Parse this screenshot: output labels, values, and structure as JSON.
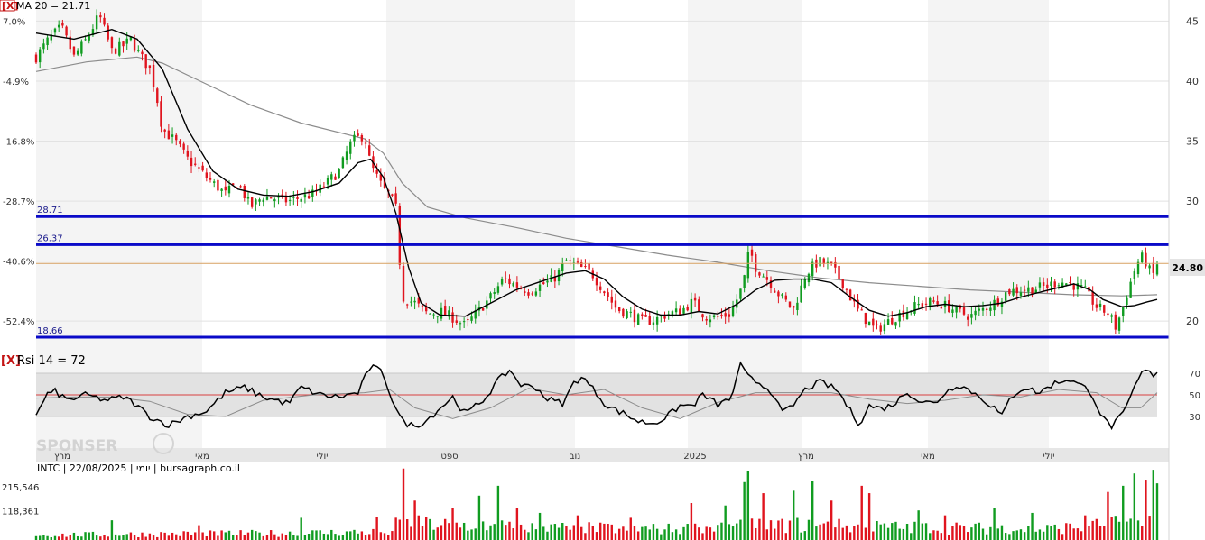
{
  "header": {
    "ma_label": "MA 20 = 21.71",
    "close_marker": "[X]"
  },
  "rsi": {
    "label": "Rsi 14 = 72",
    "close_marker": "[X]",
    "levels": [
      70,
      50,
      30
    ]
  },
  "ticker_line": "INTC | 22/08/2025 | יומי | bursagraph.co.il",
  "watermark": "SPONSER",
  "last_price_label": "24.80",
  "colors": {
    "up": "#109c20",
    "down": "#e0141e",
    "ma_fast": "#000000",
    "ma_slow": "#8c8c8c",
    "level_lines": "#0a0ac8",
    "last_price_line": "#d7a060",
    "rsi_band": "#e2e2e2",
    "rsi_mid": "#d84040"
  },
  "chart_data": [
    {
      "type": "candlestick",
      "name": "price",
      "right_axis_ticks": [
        45,
        40,
        35,
        30,
        25,
        20
      ],
      "right_axis_labels": [
        "45",
        "40",
        "35",
        "30",
        "",
        "20"
      ],
      "left_axis_ticks": [
        "7.0%",
        "-4.9%",
        "-16.8%",
        "-28.7%",
        "-40.6%",
        "-52.4%"
      ],
      "ylim": [
        17.5,
        46.3
      ],
      "x_labels": [
        "מרץ",
        "מאי",
        "יולי",
        "ספט",
        "נוב",
        "2025",
        "מרץ",
        "מאי",
        "יולי"
      ],
      "horizontal_levels": [
        {
          "label": "28.71",
          "value": 28.71
        },
        {
          "label": "26.37",
          "value": 26.37
        },
        {
          "label": "18.66",
          "value": 18.66
        }
      ],
      "last_price": 24.8,
      "close_path": [
        [
          0,
          42
        ],
        [
          10,
          43.5
        ],
        [
          20,
          44.5
        ],
        [
          30,
          42
        ],
        [
          40,
          43.5
        ],
        [
          50,
          45.5
        ],
        [
          60,
          42.5
        ],
        [
          70,
          43
        ],
        [
          75,
          43.5
        ],
        [
          80,
          42.5
        ],
        [
          90,
          41
        ],
        [
          95,
          39
        ],
        [
          100,
          36
        ],
        [
          110,
          35
        ],
        [
          120,
          33.5
        ],
        [
          130,
          32.5
        ],
        [
          140,
          31.5
        ],
        [
          150,
          30.6
        ],
        [
          160,
          31.5
        ],
        [
          170,
          29.5
        ],
        [
          180,
          30.4
        ],
        [
          200,
          30
        ],
        [
          210,
          30.3
        ],
        [
          220,
          30.6
        ],
        [
          230,
          31.5
        ],
        [
          240,
          32.5
        ],
        [
          250,
          35
        ],
        [
          260,
          35.5
        ],
        [
          265,
          33
        ],
        [
          275,
          31
        ],
        [
          280,
          30.5
        ],
        [
          285,
          29.4
        ],
        [
          290,
          22
        ],
        [
          300,
          21.5
        ],
        [
          310,
          20.6
        ],
        [
          320,
          20.8
        ],
        [
          330,
          20.3
        ],
        [
          340,
          19.6
        ],
        [
          350,
          20.8
        ],
        [
          360,
          22
        ],
        [
          370,
          23.5
        ],
        [
          380,
          23
        ],
        [
          390,
          22.5
        ],
        [
          400,
          23
        ],
        [
          410,
          23.5
        ],
        [
          420,
          25
        ],
        [
          430,
          24.5
        ],
        [
          440,
          24
        ],
        [
          450,
          22.5
        ],
        [
          460,
          21
        ],
        [
          470,
          20.6
        ],
        [
          480,
          20
        ],
        [
          490,
          20.1
        ],
        [
          500,
          20.6
        ],
        [
          510,
          20.8
        ],
        [
          520,
          21.6
        ],
        [
          530,
          20.4
        ],
        [
          540,
          20.3
        ],
        [
          550,
          20.6
        ],
        [
          560,
          23
        ],
        [
          565,
          26
        ],
        [
          570,
          24.5
        ],
        [
          580,
          23.4
        ],
        [
          590,
          22
        ],
        [
          600,
          21
        ],
        [
          610,
          24
        ],
        [
          620,
          25
        ],
        [
          630,
          24.5
        ],
        [
          640,
          23
        ],
        [
          650,
          21
        ],
        [
          660,
          19.8
        ],
        [
          665,
          19.2
        ],
        [
          670,
          19.6
        ],
        [
          680,
          20.3
        ],
        [
          690,
          20.9
        ],
        [
          700,
          21.4
        ],
        [
          710,
          21.6
        ],
        [
          720,
          21.3
        ],
        [
          730,
          20.8
        ],
        [
          740,
          20.4
        ],
        [
          750,
          21
        ],
        [
          760,
          21.6
        ],
        [
          770,
          22.5
        ],
        [
          780,
          22.6
        ],
        [
          790,
          22.7
        ],
        [
          800,
          22.9
        ],
        [
          810,
          23.3
        ],
        [
          820,
          23.1
        ],
        [
          830,
          22.6
        ],
        [
          840,
          21.2
        ],
        [
          850,
          20.6
        ],
        [
          855,
          19.5
        ],
        [
          860,
          20.8
        ],
        [
          865,
          22.6
        ],
        [
          870,
          24.2
        ],
        [
          875,
          25.4
        ],
        [
          880,
          24.8
        ],
        [
          884,
          23.6
        ],
        [
          888,
          24.8
        ]
      ],
      "ma20_path": [
        [
          0,
          44
        ],
        [
          30,
          43.5
        ],
        [
          60,
          44.3
        ],
        [
          80,
          43.5
        ],
        [
          100,
          41
        ],
        [
          120,
          36
        ],
        [
          140,
          32.5
        ],
        [
          160,
          31
        ],
        [
          180,
          30.5
        ],
        [
          200,
          30.4
        ],
        [
          220,
          30.8
        ],
        [
          240,
          31.5
        ],
        [
          255,
          33.2
        ],
        [
          265,
          33.5
        ],
        [
          275,
          32
        ],
        [
          285,
          29
        ],
        [
          295,
          24.5
        ],
        [
          305,
          21.5
        ],
        [
          320,
          20.5
        ],
        [
          340,
          20.4
        ],
        [
          360,
          21.5
        ],
        [
          380,
          22.6
        ],
        [
          400,
          23.3
        ],
        [
          420,
          24
        ],
        [
          435,
          24.2
        ],
        [
          450,
          23.5
        ],
        [
          465,
          22
        ],
        [
          480,
          21
        ],
        [
          495,
          20.5
        ],
        [
          510,
          20.5
        ],
        [
          525,
          20.8
        ],
        [
          540,
          20.6
        ],
        [
          555,
          21.4
        ],
        [
          570,
          22.6
        ],
        [
          585,
          23.4
        ],
        [
          600,
          23.5
        ],
        [
          615,
          23.5
        ],
        [
          630,
          23.2
        ],
        [
          645,
          22
        ],
        [
          660,
          20.9
        ],
        [
          675,
          20.4
        ],
        [
          690,
          20.7
        ],
        [
          705,
          21.2
        ],
        [
          720,
          21.4
        ],
        [
          735,
          21.2
        ],
        [
          750,
          21.3
        ],
        [
          765,
          21.5
        ],
        [
          780,
          22
        ],
        [
          795,
          22.4
        ],
        [
          810,
          22.8
        ],
        [
          822,
          23.1
        ],
        [
          835,
          22.6
        ],
        [
          845,
          21.8
        ],
        [
          860,
          21.2
        ],
        [
          870,
          21.3
        ],
        [
          880,
          21.6
        ],
        [
          888,
          21.8
        ]
      ],
      "ma200_path": [
        [
          0,
          40.8
        ],
        [
          40,
          41.6
        ],
        [
          80,
          42
        ],
        [
          100,
          41.5
        ],
        [
          130,
          40
        ],
        [
          170,
          38
        ],
        [
          210,
          36.5
        ],
        [
          260,
          35.2
        ],
        [
          275,
          34
        ],
        [
          290,
          31.5
        ],
        [
          310,
          29.5
        ],
        [
          340,
          28.6
        ],
        [
          380,
          27.8
        ],
        [
          420,
          26.9
        ],
        [
          460,
          26.2
        ],
        [
          500,
          25.5
        ],
        [
          540,
          24.9
        ],
        [
          580,
          24.2
        ],
        [
          620,
          23.6
        ],
        [
          660,
          23.2
        ],
        [
          700,
          22.9
        ],
        [
          740,
          22.6
        ],
        [
          780,
          22.4
        ],
        [
          820,
          22.2
        ],
        [
          860,
          22.1
        ],
        [
          888,
          22.2
        ]
      ],
      "volume_ticks": [
        215546,
        118361
      ],
      "volume_labels": [
        "215,546",
        "118,361"
      ]
    },
    {
      "type": "line",
      "name": "RSI 14",
      "ylim": [
        5,
        100
      ],
      "levels": [
        70,
        50,
        30
      ],
      "rsi_path": [
        [
          0,
          30
        ],
        [
          8,
          50
        ],
        [
          15,
          53
        ],
        [
          25,
          45
        ],
        [
          40,
          50
        ],
        [
          55,
          45
        ],
        [
          70,
          48
        ],
        [
          80,
          40
        ],
        [
          90,
          30
        ],
        [
          105,
          22
        ],
        [
          120,
          30
        ],
        [
          135,
          35
        ],
        [
          150,
          52
        ],
        [
          165,
          57
        ],
        [
          180,
          48
        ],
        [
          200,
          42
        ],
        [
          210,
          57
        ],
        [
          225,
          50
        ],
        [
          240,
          48
        ],
        [
          255,
          52
        ],
        [
          265,
          77
        ],
        [
          275,
          70
        ],
        [
          280,
          52
        ],
        [
          290,
          25
        ],
        [
          300,
          21
        ],
        [
          310,
          27
        ],
        [
          320,
          38
        ],
        [
          330,
          48
        ],
        [
          340,
          32
        ],
        [
          355,
          46
        ],
        [
          365,
          62
        ],
        [
          375,
          73
        ],
        [
          385,
          58
        ],
        [
          395,
          58
        ],
        [
          405,
          46
        ],
        [
          418,
          42
        ],
        [
          425,
          60
        ],
        [
          432,
          67
        ],
        [
          440,
          57
        ],
        [
          452,
          40
        ],
        [
          465,
          33
        ],
        [
          478,
          25
        ],
        [
          490,
          24
        ],
        [
          500,
          30
        ],
        [
          510,
          40
        ],
        [
          520,
          40
        ],
        [
          528,
          50
        ],
        [
          540,
          41
        ],
        [
          550,
          46
        ],
        [
          558,
          77
        ],
        [
          565,
          65
        ],
        [
          575,
          60
        ],
        [
          585,
          50
        ],
        [
          590,
          33
        ],
        [
          598,
          38
        ],
        [
          610,
          56
        ],
        [
          622,
          62
        ],
        [
          635,
          54
        ],
        [
          645,
          35
        ],
        [
          652,
          23
        ],
        [
          660,
          40
        ],
        [
          670,
          37
        ],
        [
          680,
          42
        ],
        [
          690,
          53
        ],
        [
          700,
          44
        ],
        [
          712,
          42
        ],
        [
          720,
          52
        ],
        [
          730,
          60
        ],
        [
          740,
          54
        ],
        [
          750,
          46
        ],
        [
          760,
          37
        ],
        [
          765,
          30
        ],
        [
          772,
          48
        ],
        [
          782,
          57
        ],
        [
          795,
          52
        ],
        [
          805,
          60
        ],
        [
          818,
          65
        ],
        [
          825,
          60
        ],
        [
          835,
          54
        ],
        [
          845,
          28
        ],
        [
          852,
          21
        ],
        [
          862,
          33
        ],
        [
          870,
          57
        ],
        [
          878,
          74
        ],
        [
          884,
          68
        ],
        [
          888,
          72
        ]
      ],
      "rsi_ma_path": [
        [
          0,
          47
        ],
        [
          30,
          48
        ],
        [
          60,
          48
        ],
        [
          90,
          44
        ],
        [
          120,
          32
        ],
        [
          150,
          30
        ],
        [
          180,
          45
        ],
        [
          220,
          50
        ],
        [
          260,
          52
        ],
        [
          280,
          55
        ],
        [
          300,
          38
        ],
        [
          330,
          28
        ],
        [
          360,
          38
        ],
        [
          390,
          56
        ],
        [
          420,
          50
        ],
        [
          450,
          55
        ],
        [
          480,
          38
        ],
        [
          510,
          28
        ],
        [
          540,
          43
        ],
        [
          570,
          52
        ],
        [
          600,
          52
        ],
        [
          630,
          52
        ],
        [
          660,
          46
        ],
        [
          690,
          42
        ],
        [
          720,
          45
        ],
        [
          750,
          50
        ],
        [
          780,
          48
        ],
        [
          810,
          55
        ],
        [
          840,
          52
        ],
        [
          860,
          38
        ],
        [
          875,
          38
        ],
        [
          888,
          52
        ]
      ]
    },
    {
      "type": "bar",
      "name": "volume",
      "ylim": [
        0,
        300000
      ],
      "volume_spikes": [
        [
          60,
          80000
        ],
        [
          130,
          60000
        ],
        [
          210,
          90000
        ],
        [
          270,
          95000
        ],
        [
          290,
          290000
        ],
        [
          300,
          160000
        ],
        [
          330,
          130000
        ],
        [
          350,
          180000
        ],
        [
          365,
          220000
        ],
        [
          380,
          130000
        ],
        [
          400,
          110000
        ],
        [
          430,
          100000
        ],
        [
          470,
          90000
        ],
        [
          520,
          150000
        ],
        [
          545,
          140000
        ],
        [
          560,
          235000
        ],
        [
          565,
          280000
        ],
        [
          575,
          190000
        ],
        [
          600,
          200000
        ],
        [
          615,
          240000
        ],
        [
          630,
          160000
        ],
        [
          655,
          220000
        ],
        [
          660,
          190000
        ],
        [
          700,
          120000
        ],
        [
          720,
          100000
        ],
        [
          760,
          130000
        ],
        [
          790,
          110000
        ],
        [
          830,
          100000
        ],
        [
          850,
          195000
        ],
        [
          860,
          220000
        ],
        [
          870,
          270000
        ],
        [
          878,
          245000
        ],
        [
          884,
          285000
        ],
        [
          888,
          230000
        ]
      ],
      "volume_base": [
        [
          0,
          18000
        ],
        [
          100,
          22000
        ],
        [
          200,
          25000
        ],
        [
          280,
          30000
        ],
        [
          300,
          60000
        ],
        [
          400,
          45000
        ],
        [
          500,
          40000
        ],
        [
          600,
          55000
        ],
        [
          700,
          45000
        ],
        [
          800,
          40000
        ],
        [
          888,
          70000
        ]
      ]
    }
  ]
}
